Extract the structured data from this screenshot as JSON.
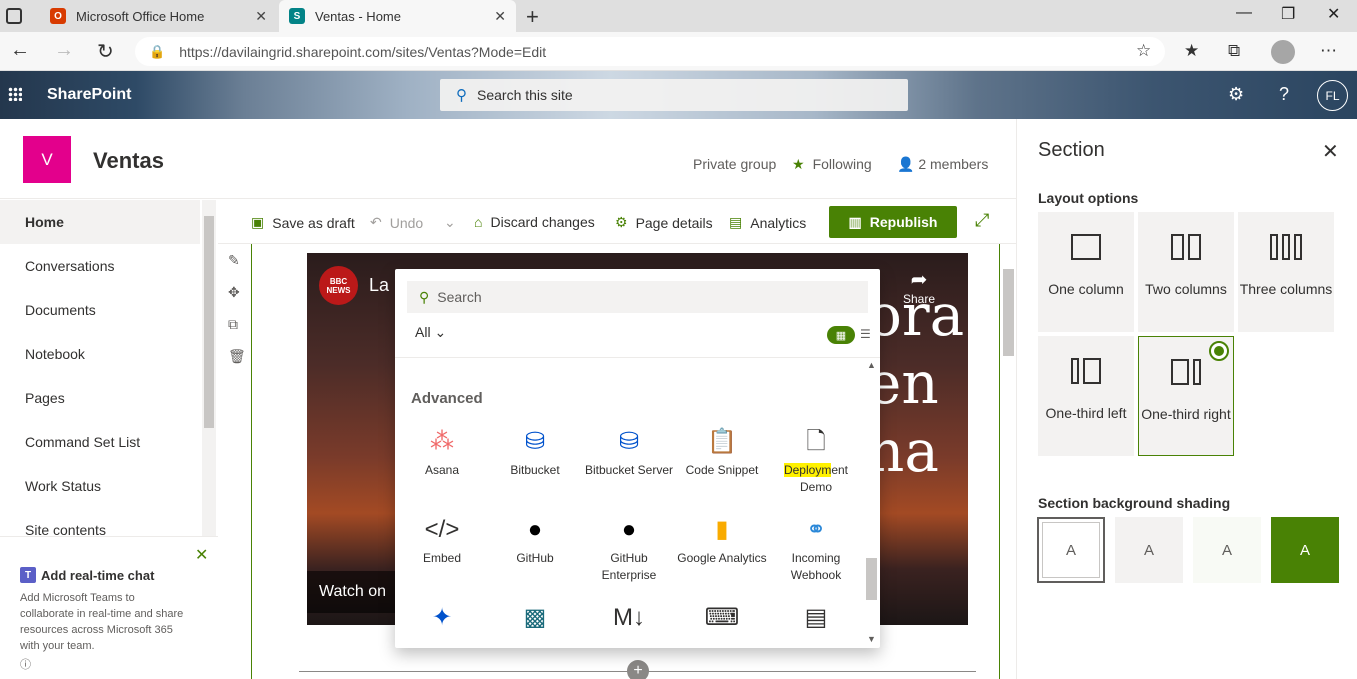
{
  "browser": {
    "tabs": [
      {
        "title": "Microsoft Office Home",
        "active": false
      },
      {
        "title": "Ventas - Home",
        "active": true
      }
    ],
    "url": "https://davilaingrid.sharepoint.com/sites/Ventas?Mode=Edit"
  },
  "suite": {
    "app_name": "SharePoint",
    "search_placeholder": "Search this site",
    "avatar_initials": "FL"
  },
  "site": {
    "logo_letter": "V",
    "name": "Ventas",
    "privacy": "Private group",
    "following": "Following",
    "members": "2 members"
  },
  "nav": {
    "items": [
      "Home",
      "Conversations",
      "Documents",
      "Notebook",
      "Pages",
      "Command Set List",
      "Work Status",
      "Site contents"
    ],
    "selected": "Home"
  },
  "teams_card": {
    "title": "Add real-time chat",
    "description": "Add Microsoft Teams to collaborate in real-time and share resources across Microsoft 365 with your team."
  },
  "commandbar": {
    "save_draft": "Save as draft",
    "undo": "Undo",
    "discard": "Discard changes",
    "page_details": "Page details",
    "analytics": "Analytics",
    "republish": "Republish"
  },
  "video": {
    "channel_badge": "BBC NEWS",
    "title": "La",
    "share": "Share",
    "watch_on": "Watch on",
    "overlay_lines": [
      "ora",
      "en",
      "na"
    ]
  },
  "toolbox": {
    "search_placeholder": "Search",
    "filter": "All",
    "section_heading": "Advanced",
    "items": [
      {
        "label": "Asana",
        "icon": "asana-icon"
      },
      {
        "label": "Bitbucket",
        "icon": "bitbucket-icon"
      },
      {
        "label": "Bitbucket Server",
        "icon": "bitbucket-server-icon"
      },
      {
        "label": "Code Snippet",
        "icon": "code-snippet-icon"
      },
      {
        "label": "Deployment Demo",
        "icon": "document-icon"
      },
      {
        "label": "Embed",
        "icon": "embed-icon"
      },
      {
        "label": "GitHub",
        "icon": "github-icon"
      },
      {
        "label": "GitHub Enterprise",
        "icon": "github-enterprise-icon"
      },
      {
        "label": "Google Analytics",
        "icon": "google-analytics-icon"
      },
      {
        "label": "Incoming Webhook",
        "icon": "webhook-icon"
      }
    ]
  },
  "section_pane": {
    "title": "Section",
    "layout_label": "Layout options",
    "layouts": [
      {
        "label": "One column",
        "selected": false
      },
      {
        "label": "Two columns",
        "selected": false
      },
      {
        "label": "Three columns",
        "selected": false
      },
      {
        "label": "One-third left",
        "selected": false
      },
      {
        "label": "One-third right",
        "selected": true
      }
    ],
    "shading_label": "Section background shading",
    "shading_glyph": "A",
    "shading_colors": [
      "#ffffff",
      "#f3f2f1",
      "#f8faf5",
      "#498205"
    ]
  },
  "colors": {
    "accent": "#498205",
    "site_logo": "#e3008c"
  }
}
